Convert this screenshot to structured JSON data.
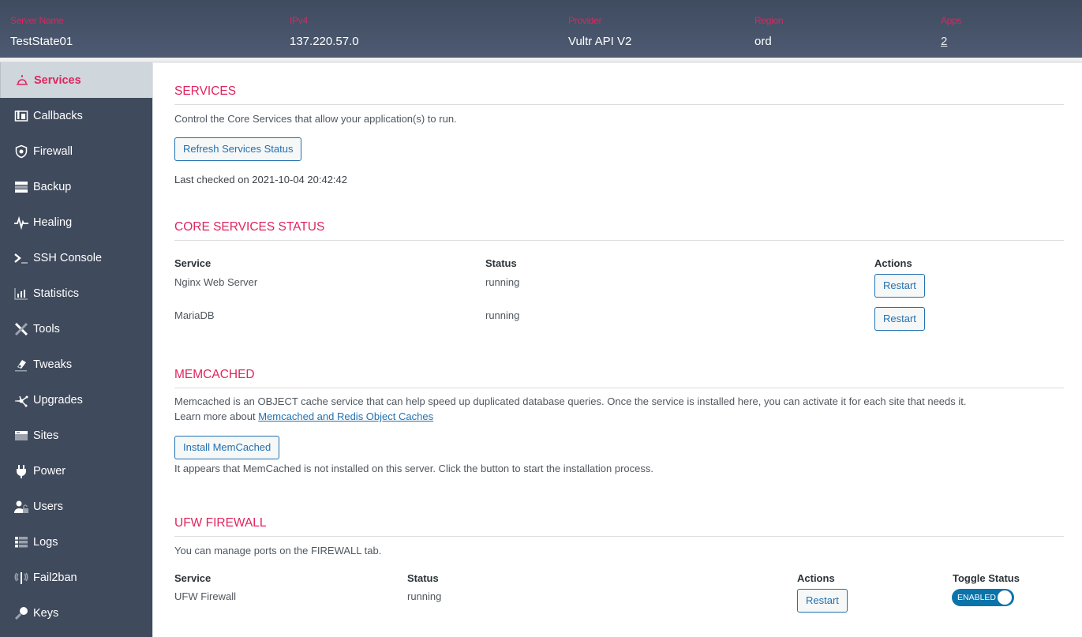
{
  "header": {
    "columns": [
      {
        "label": "Server Name",
        "value": "TestState01"
      },
      {
        "label": "IPv4",
        "value": "137.220.57.0"
      },
      {
        "label": "Provider",
        "value": "Vultr API V2"
      },
      {
        "label": "Region",
        "value": "ord"
      },
      {
        "label": "Apps",
        "value": "2"
      }
    ]
  },
  "sidebar": {
    "items": [
      {
        "label": "Services",
        "icon": "bell-icon",
        "active": true
      },
      {
        "label": "Callbacks",
        "icon": "callbacks-icon"
      },
      {
        "label": "Firewall",
        "icon": "shield-icon"
      },
      {
        "label": "Backup",
        "icon": "server-icon"
      },
      {
        "label": "Healing",
        "icon": "heartbeat-icon"
      },
      {
        "label": "SSH Console",
        "icon": "terminal-icon"
      },
      {
        "label": "Statistics",
        "icon": "bar-chart-icon"
      },
      {
        "label": "Tools",
        "icon": "tools-icon"
      },
      {
        "label": "Tweaks",
        "icon": "tweaks-icon"
      },
      {
        "label": "Upgrades",
        "icon": "network-icon"
      },
      {
        "label": "Sites",
        "icon": "browser-window-icon"
      },
      {
        "label": "Power",
        "icon": "plug-icon"
      },
      {
        "label": "Users",
        "icon": "user-lock-icon"
      },
      {
        "label": "Logs",
        "icon": "list-icon"
      },
      {
        "label": "Fail2ban",
        "icon": "antenna-icon"
      },
      {
        "label": "Keys",
        "icon": "key-icon"
      }
    ]
  },
  "services": {
    "title": "SERVICES",
    "description": "Control the Core Services that allow your application(s) to run.",
    "refresh_button": "Refresh Services Status",
    "last_checked": "Last checked on 2021-10-04 20:42:42"
  },
  "core": {
    "title": "CORE SERVICES STATUS",
    "headers": {
      "service": "Service",
      "status": "Status",
      "actions": "Actions"
    },
    "rows": [
      {
        "service": "Nginx Web Server",
        "status": "running",
        "action": "Restart"
      },
      {
        "service": "MariaDB",
        "status": "running",
        "action": "Restart"
      }
    ]
  },
  "memcached": {
    "title": "MEMCACHED",
    "description": "Memcached is an OBJECT cache service that can help speed up duplicated database queries. Once the service is installed here, you can activate it for each site that needs it.",
    "learn_prefix": "Learn more about ",
    "learn_link": "Memcached and Redis Object Caches",
    "install_button": "Install MemCached",
    "note": "It appears that MemCached is not installed on this server. Click the button to start the installation process."
  },
  "ufw": {
    "title": "UFW FIREWALL",
    "description": "You can manage ports on the FIREWALL tab.",
    "headers": {
      "service": "Service",
      "status": "Status",
      "actions": "Actions",
      "toggle": "Toggle Status"
    },
    "row": {
      "service": "UFW Firewall",
      "status": "running",
      "action": "Restart",
      "toggle": "ENABLED"
    }
  },
  "colors": {
    "accent": "#e0245e",
    "link": "#2271b1",
    "toggle": "#0a73aa",
    "sidebar": "#3f4a5c"
  }
}
